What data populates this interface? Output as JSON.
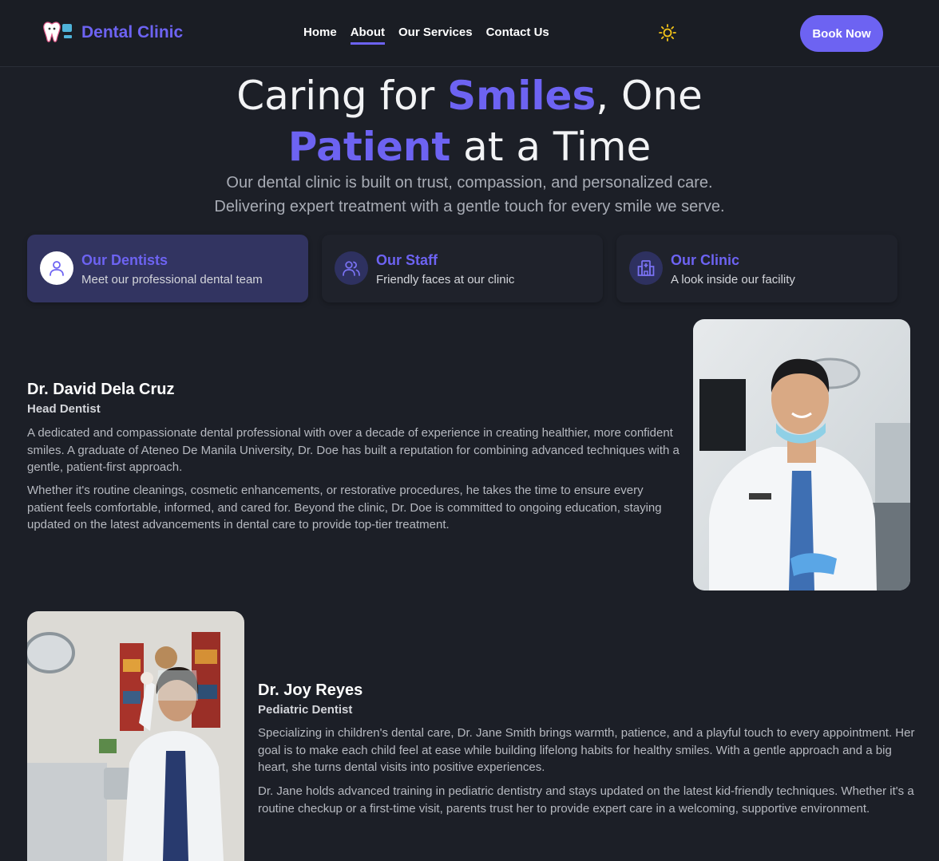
{
  "header": {
    "brand": "Dental Clinic",
    "nav": [
      {
        "label": "Home"
      },
      {
        "label": "About"
      },
      {
        "label": "Our Services"
      },
      {
        "label": "Contact Us"
      }
    ],
    "book_label": "Book Now",
    "accent_color": "#6d63f2"
  },
  "hero": {
    "line1_pre": "Caring for ",
    "line1_accent": "Smiles",
    "line1_post": ", One",
    "line2_accent": "Patient",
    "line2_post": " at a Time",
    "sub1": "Our dental clinic is built on trust, compassion, and personalized care.",
    "sub2": "Delivering expert treatment with a gentle touch for every smile we serve."
  },
  "tabs": [
    {
      "title": "Our Dentists",
      "desc": "Meet our professional dental team",
      "icon": "user-icon"
    },
    {
      "title": "Our Staff",
      "desc": "Friendly faces at our clinic",
      "icon": "users-icon"
    },
    {
      "title": "Our Clinic",
      "desc": "A look inside our facility",
      "icon": "hospital-icon"
    }
  ],
  "doctors": [
    {
      "name": "Dr. David Dela Cruz",
      "role": "Head Dentist",
      "p1": "A dedicated and compassionate dental professional with over a decade of experience in creating healthier, more confident smiles. A graduate of Ateneo De Manila University, Dr. Doe has built a reputation for combining advanced techniques with a gentle, patient-first approach.",
      "p2": "Whether it's routine cleanings, cosmetic enhancements, or restorative procedures, he takes the time to ensure every patient feels comfortable, informed, and cared for. Beyond the clinic, Dr. Doe is committed to ongoing education, staying updated on the latest advancements in dental care to provide top-tier treatment."
    },
    {
      "name": "Dr. Joy Reyes",
      "role": "Pediatric Dentist",
      "p1": "Specializing in children's dental care, Dr. Jane Smith brings warmth, patience, and a playful touch to every appointment. Her goal is to make each child feel at ease while building lifelong habits for healthy smiles. With a gentle approach and a big heart, she turns dental visits into positive experiences.",
      "p2": "Dr. Jane holds advanced training in pediatric dentistry and stays updated on the latest kid-friendly techniques. Whether it's a routine checkup or a first-time visit, parents trust her to provide expert care in a welcoming, supportive environment."
    }
  ]
}
